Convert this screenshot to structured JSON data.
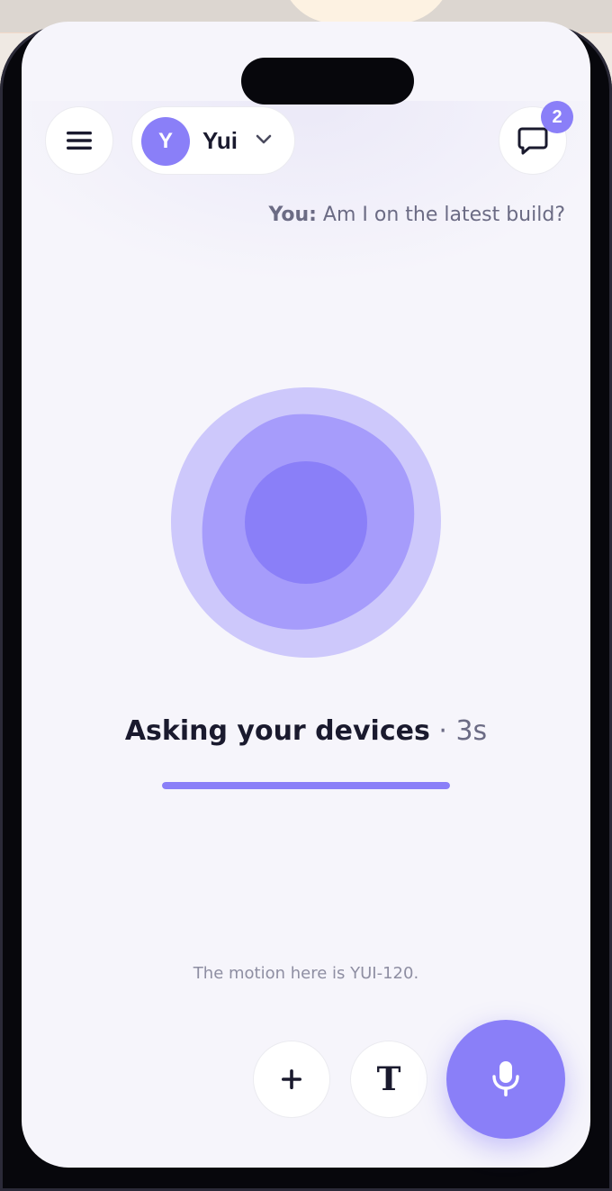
{
  "header": {
    "menu_icon": "hamburger-menu-icon",
    "profile": {
      "avatar_initial": "Y",
      "name": "Yui",
      "dropdown_icon": "chevron-down-icon"
    },
    "chat": {
      "icon": "chat-bubble-icon",
      "badge_count": "2"
    }
  },
  "transcript": {
    "speaker": "You:",
    "text": " Am I on the latest build?"
  },
  "status": {
    "title": "Asking your devices",
    "separator": " · ",
    "elapsed": "3s",
    "progress": 1.0
  },
  "footnote": "The motion here is YUI-120.",
  "actions": {
    "add_icon": "plus-icon",
    "text_button_glyph": "T",
    "text_icon": "text-mode-icon",
    "mic_icon": "microphone-icon"
  },
  "colors": {
    "accent": "#8a7ff8",
    "accent_mid": "#a69cfb",
    "accent_light": "#cdc8fb",
    "background": "#f6f5fb",
    "text_primary": "#1a1a2e",
    "text_secondary": "#6b6b84"
  }
}
